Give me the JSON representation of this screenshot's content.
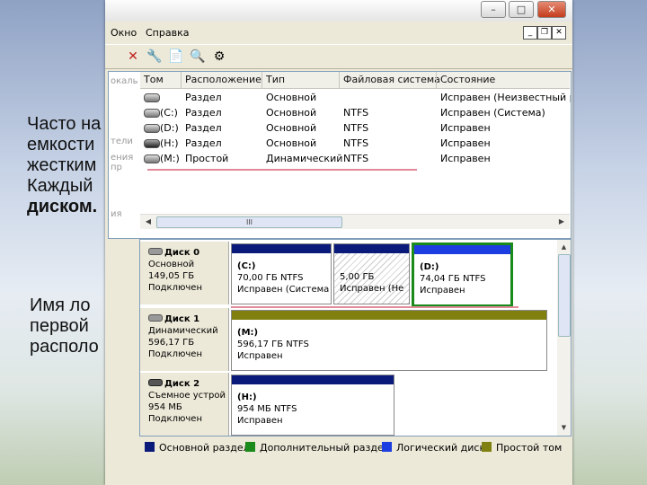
{
  "slide": {
    "lines": [
      "Часто на",
      "емкости",
      "жестким",
      "Каждый",
      "диском."
    ],
    "lines2": [
      "Имя ло",
      "первой",
      "располо"
    ]
  },
  "window": {
    "menu": [
      "Окно",
      "Справка"
    ],
    "left_strip": [
      "окаль",
      "тели",
      "ения пр",
      "ия"
    ],
    "columns": [
      "Том",
      "Расположение",
      "Тип",
      "Файловая система",
      "Состояние"
    ],
    "volumes": [
      {
        "vol": "",
        "layout": "Раздел",
        "type": "Основной",
        "fs": "",
        "status": "Исправен (Неизвестный ра"
      },
      {
        "vol": "(C:)",
        "layout": "Раздел",
        "type": "Основной",
        "fs": "NTFS",
        "status": "Исправен (Система)"
      },
      {
        "vol": "(D:)",
        "layout": "Раздел",
        "type": "Основной",
        "fs": "NTFS",
        "status": "Исправен"
      },
      {
        "vol": "(H:)",
        "layout": "Раздел",
        "type": "Основной",
        "fs": "NTFS",
        "status": "Исправен"
      },
      {
        "vol": "(M:)",
        "layout": "Простой",
        "type": "Динамический",
        "fs": "NTFS",
        "status": "Исправен"
      }
    ],
    "disks": [
      {
        "name": "Диск 0",
        "type": "Основной",
        "size": "149,05 ГБ",
        "state": "Подключен",
        "partitions": [
          {
            "label": "(C:)",
            "size": "70,00 ГБ NTFS",
            "status": "Исправен (Система",
            "bar": "#0a1a7a"
          },
          {
            "label": "",
            "size": "5,00 ГБ",
            "status": "Исправен (Не",
            "bar": "#0a1a7a"
          },
          {
            "label": "(D:)",
            "size": "74,04 ГБ NTFS",
            "status": "Исправен",
            "bar": "#1d3de0"
          }
        ]
      },
      {
        "name": "Диск 1",
        "type": "Динамический",
        "size": "596,17 ГБ",
        "state": "Подключен",
        "partitions": [
          {
            "label": "(M:)",
            "size": "596,17 ГБ NTFS",
            "status": "Исправен",
            "bar": "#808010"
          }
        ]
      },
      {
        "name": "Диск 2",
        "type": "Съемное устрой",
        "size": "954 МБ",
        "state": "Подключен",
        "partitions": [
          {
            "label": "(H:)",
            "size": "954 МБ NTFS",
            "status": "Исправен",
            "bar": "#0a1a7a"
          }
        ]
      }
    ],
    "legend": [
      {
        "label": "Основной раздел",
        "color": "#0a1a7a"
      },
      {
        "label": "Дополнительный раздел",
        "color": "#1a8a1a"
      },
      {
        "label": "Логический диск",
        "color": "#1d3de0"
      },
      {
        "label": "Простой том",
        "color": "#808010"
      }
    ],
    "scroll_glyph": "III"
  }
}
